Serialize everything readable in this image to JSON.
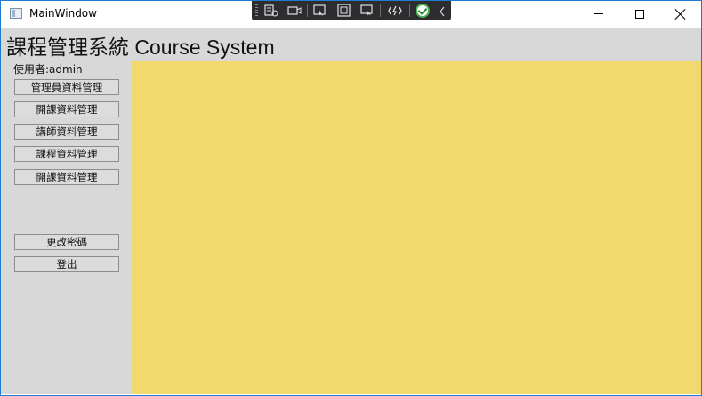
{
  "window": {
    "title": "MainWindow",
    "minimize_label": "Minimize",
    "maximize_label": "Maximize",
    "close_label": "Close"
  },
  "debug_toolbar": {
    "items": [
      "live-visual-tree-icon",
      "video-icon",
      "select-element-icon",
      "display-layout-adorners-icon",
      "track-focus-icon",
      "hot-reload-icon",
      "status-ok-icon",
      "collapse-icon"
    ]
  },
  "header": {
    "title": "課程管理系統 Course System"
  },
  "sidebar": {
    "user_label": "使用者:admin",
    "buttons": [
      {
        "label": "管理員資料管理"
      },
      {
        "label": "開課資料管理"
      },
      {
        "label": "講師資料管理"
      },
      {
        "label": "課程資料管理"
      },
      {
        "label": "開課資料管理"
      }
    ],
    "divider": "-------------",
    "account_buttons": [
      {
        "label": "更改密碼"
      },
      {
        "label": "登出"
      }
    ]
  },
  "colors": {
    "content_background": "#f1d96d",
    "sidebar_background": "#d8d8d8",
    "window_border": "#1e7bd1"
  }
}
